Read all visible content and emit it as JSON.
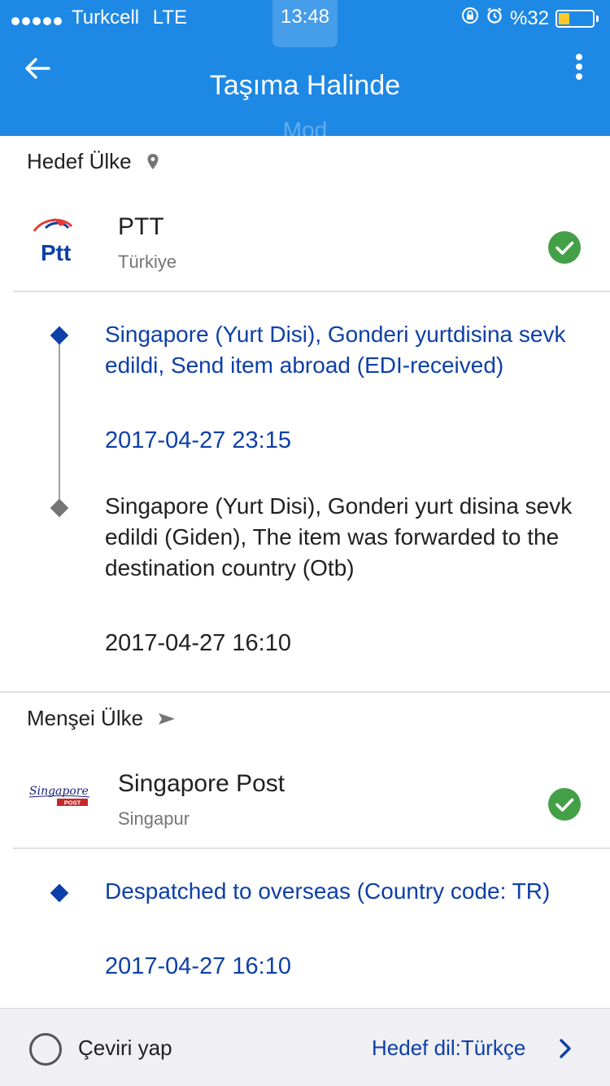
{
  "status_bar": {
    "carrier": "Turkcell",
    "network": "LTE",
    "time": "13:48",
    "battery_text": "%32",
    "battery_level": 0.32,
    "icons": [
      "lock-rotation-icon",
      "alarm-icon",
      "battery-icon"
    ]
  },
  "header": {
    "title": "Taşıma Halinde",
    "ghost_text": "Mod",
    "back_icon": "arrow-left-icon",
    "menu_icon": "more-vert-icon"
  },
  "destination": {
    "section_label": "Hedef Ülke",
    "section_icon": "location-pin-icon",
    "carrier_name": "PTT",
    "carrier_country": "Türkiye",
    "logo_text": "Ptt",
    "status_icon": "check-circle-icon",
    "events": [
      {
        "text": "Singapore (Yurt Disi), Gonderi yurtdisina sevk edildi, Send item abroad (EDI-received)",
        "datetime": "2017-04-27 23:15",
        "highlighted": true
      },
      {
        "text": "Singapore (Yurt Disi), Gonderi yurt disina sevk edildi (Giden), The item was forwarded to the destination country (Otb)",
        "datetime": "2017-04-27 16:10",
        "highlighted": false
      }
    ]
  },
  "origin": {
    "section_label": "Menşei Ülke",
    "section_icon": "send-arrow-icon",
    "carrier_name": "Singapore Post",
    "carrier_country": "Singapur",
    "logo_text": "Singapore",
    "logo_subtext": "POST",
    "status_icon": "check-circle-icon",
    "events": [
      {
        "text": "Despatched to overseas (Country code: TR)",
        "datetime": "2017-04-27 16:10",
        "highlighted": true
      }
    ]
  },
  "footer": {
    "translate_label": "Çeviri yap",
    "target_language": "Hedef dil:Türkçe",
    "chevron_icon": "chevron-right-icon"
  },
  "colors": {
    "header_bg": "#1e88e5",
    "link_blue": "#0d3fa8",
    "success_green": "#43a047",
    "ptt_blue": "#0d3fa8",
    "ptt_red": "#e53935",
    "singpost_red": "#c62828"
  }
}
